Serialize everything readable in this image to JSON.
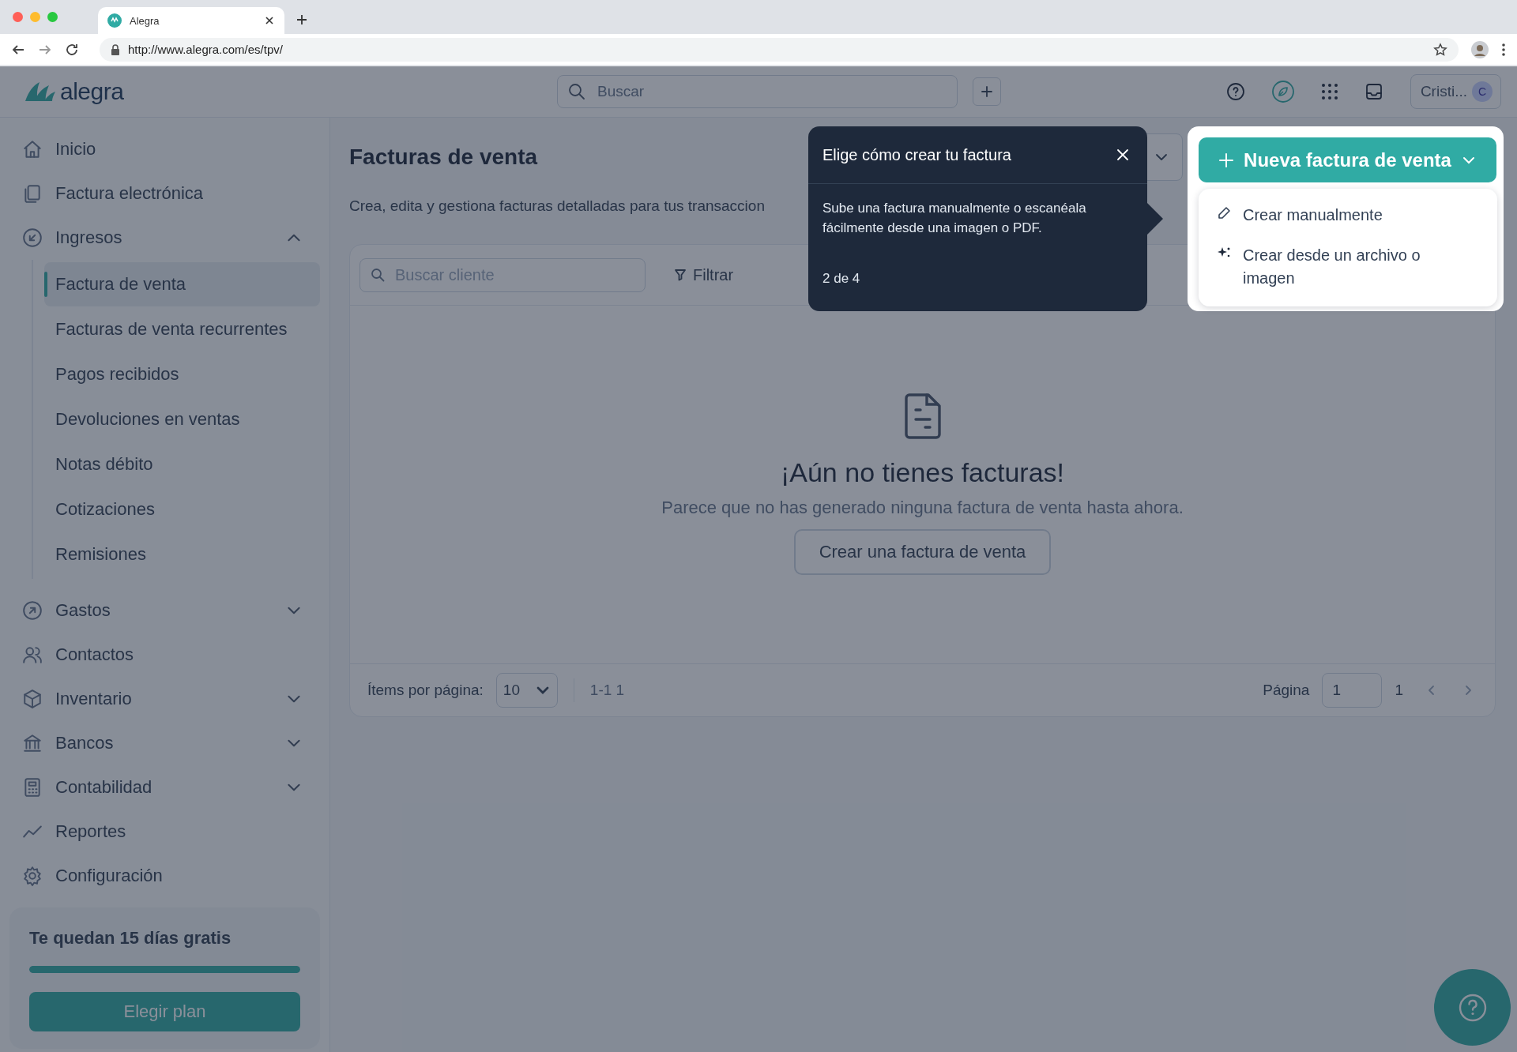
{
  "browser": {
    "tab_title": "Alegra",
    "url": "http://www.alegra.com/es/tpv/"
  },
  "header": {
    "logo": "alegra",
    "search": {
      "placeholder": "Buscar"
    },
    "user": {
      "name": "Cristi...",
      "initial": "C"
    }
  },
  "sidebar": {
    "items": [
      {
        "label": "Inicio"
      },
      {
        "label": "Factura electrónica"
      },
      {
        "label": "Ingresos",
        "expanded": true,
        "children": [
          {
            "label": "Factura de venta",
            "selected": true
          },
          {
            "label": "Facturas de venta recurrentes",
            "selected": false
          },
          {
            "label": "Pagos recibidos",
            "selected": false
          },
          {
            "label": "Devoluciones en ventas",
            "selected": false
          },
          {
            "label": "Notas débito",
            "selected": false
          },
          {
            "label": "Cotizaciones",
            "selected": false
          },
          {
            "label": "Remisiones",
            "selected": false
          }
        ]
      },
      {
        "label": "Gastos",
        "expanded": false
      },
      {
        "label": "Contactos"
      },
      {
        "label": "Inventario",
        "expanded": false
      },
      {
        "label": "Bancos",
        "expanded": false
      },
      {
        "label": "Contabilidad",
        "expanded": false
      },
      {
        "label": "Reportes"
      },
      {
        "label": "Configuración"
      }
    ],
    "trial": {
      "text": "Te quedan 15 días gratis",
      "level": 1,
      "button": "Elegir plan"
    }
  },
  "main": {
    "title": "Facturas de venta",
    "subtitle": "Crea, edita y gestiona facturas detalladas para tus transaccion",
    "toolbar": {
      "search": {
        "placeholder": "Buscar cliente"
      },
      "filter": "Filtrar"
    },
    "empty_state": {
      "title": "¡Aún no tienes facturas!",
      "message": "Parece que no has generado ninguna factura de venta hasta ahora.",
      "button": "Crear una factura de venta"
    },
    "footer": {
      "items_label": "Ítems por página:",
      "page_size": "10",
      "range": "1-1 1",
      "page_label": "Página",
      "page": "1",
      "total_pages": "1"
    }
  },
  "tour": {
    "title": "Elige cómo crear tu factura",
    "body": "Sube una factura manualmente o escanéala fácilmente desde una imagen o PDF.",
    "step": "2 de 4"
  },
  "spotlight": {
    "button": "Nueva factura de venta",
    "menu": [
      {
        "label": "Crear manualmente"
      },
      {
        "label": "Crear desde un archivo o imagen"
      }
    ]
  }
}
